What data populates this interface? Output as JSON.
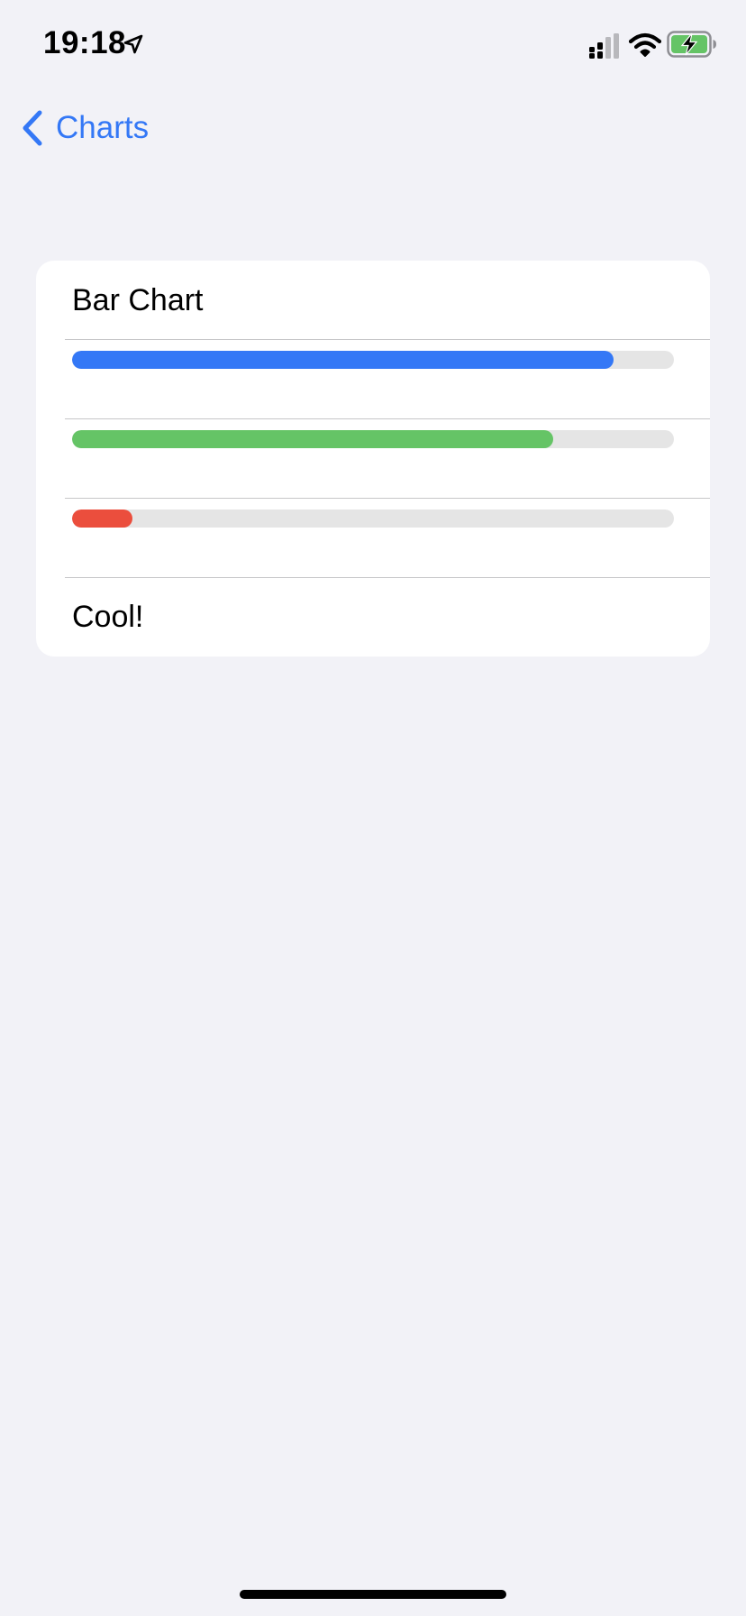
{
  "status_bar": {
    "time": "19:18",
    "icons": [
      "location-arrow",
      "cellular-signal",
      "wifi",
      "battery-charging"
    ]
  },
  "nav": {
    "back_label": "Charts",
    "back_icon": "chevron-left",
    "accent_color": "#3478f6"
  },
  "card": {
    "title": "Bar Chart",
    "footer": "Cool!"
  },
  "chart_data": {
    "type": "bar",
    "orientation": "horizontal",
    "values": [
      0.9,
      0.8,
      0.1
    ],
    "colors": [
      "#3478f6",
      "#65c466",
      "#eb4e3d"
    ],
    "track_color": "#e5e5e5",
    "xlim": [
      0,
      1
    ]
  }
}
